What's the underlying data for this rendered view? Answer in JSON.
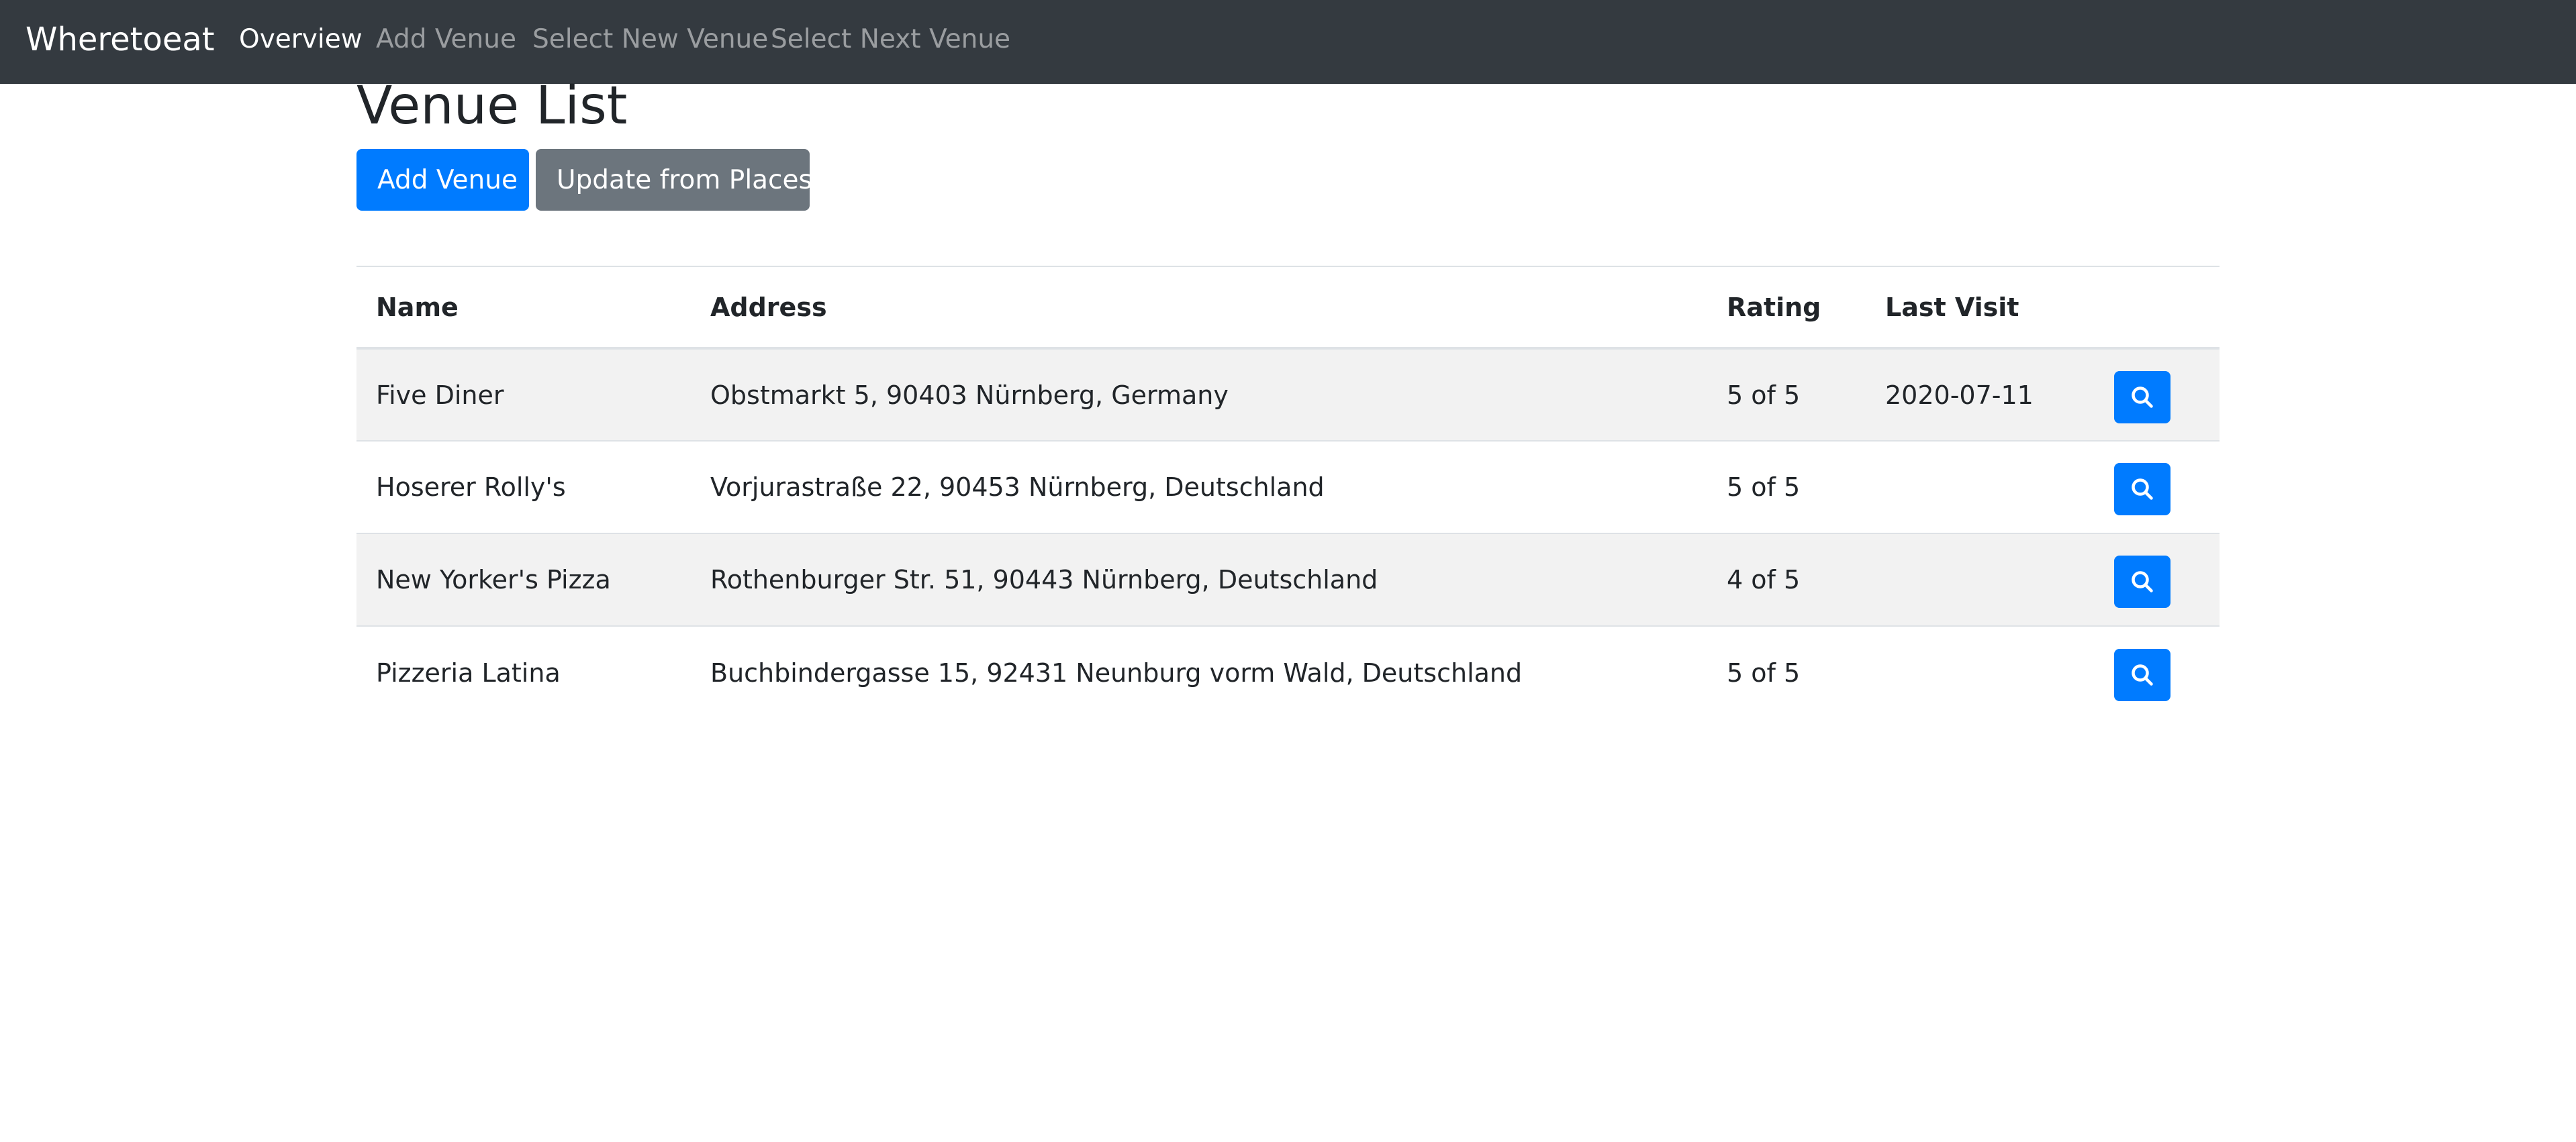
{
  "navbar": {
    "brand": "Wheretoeat",
    "links": [
      {
        "label": "Overview",
        "active": true
      },
      {
        "label": "Add Venue",
        "active": false
      },
      {
        "label": "Select New Venue",
        "active": false
      },
      {
        "label": "Select Next Venue",
        "active": false
      }
    ]
  },
  "page": {
    "title": "Venue List",
    "add_venue_button": "Add Venue",
    "update_button": "Update from Places"
  },
  "table": {
    "headers": {
      "name": "Name",
      "address": "Address",
      "rating": "Rating",
      "last_visit": "Last Visit"
    },
    "rows": [
      {
        "name": "Five Diner",
        "address": "Obstmarkt 5, 90403 Nürnberg, Germany",
        "rating": "5 of 5",
        "last_visit": "2020-07-11",
        "action_icon": "search-icon"
      },
      {
        "name": "Hoserer Rolly's",
        "address": "Vorjurastraße 22, 90453 Nürnberg, Deutschland",
        "rating": "5 of 5",
        "last_visit": "",
        "action_icon": "search-icon"
      },
      {
        "name": "New Yorker's Pizza",
        "address": "Rothenburger Str. 51, 90443 Nürnberg, Deutschland",
        "rating": "4 of 5",
        "last_visit": "",
        "action_icon": "search-icon"
      },
      {
        "name": "Pizzeria Latina",
        "address": "Buchbindergasse 15, 92431 Neunburg vorm Wald, Deutschland",
        "rating": "5 of 5",
        "last_visit": "",
        "action_icon": "search-icon"
      }
    ]
  },
  "colors": {
    "navbar_bg": "#343a40",
    "primary": "#007bff",
    "secondary": "#6c757d",
    "stripe": "#f2f2f2"
  }
}
